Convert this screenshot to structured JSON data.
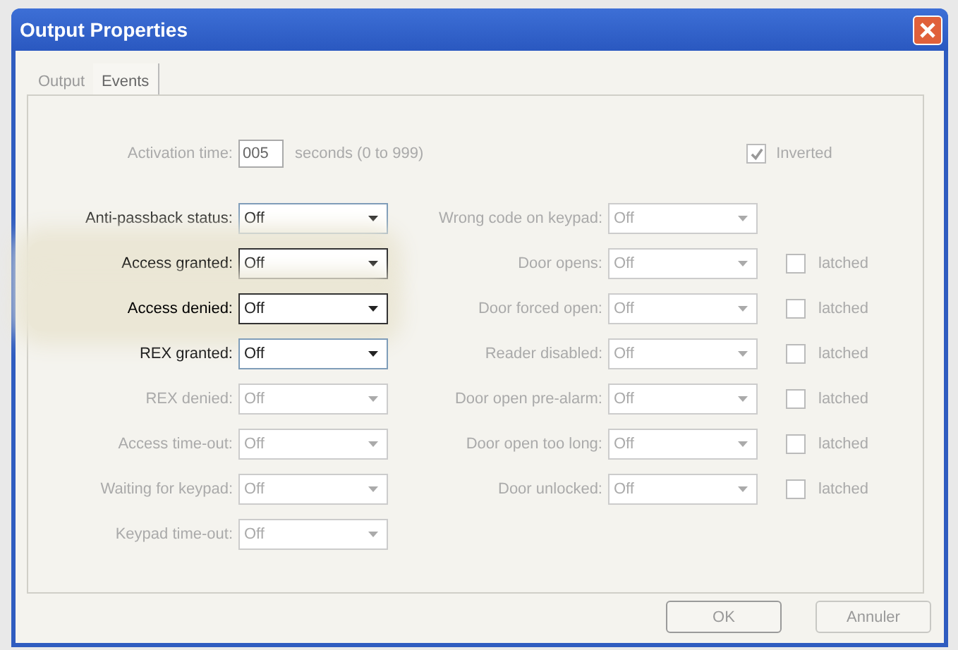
{
  "window": {
    "title": "Output Properties"
  },
  "tabs": [
    {
      "label": "Output",
      "selected": false
    },
    {
      "label": "Events",
      "selected": true
    }
  ],
  "activation": {
    "label": "Activation time:",
    "value": "005",
    "hint": "seconds (0 to 999)",
    "disabled": true
  },
  "inverted": {
    "label": "Inverted",
    "checked": true,
    "disabled": true
  },
  "left_events": [
    {
      "label": "Anti-passback status:",
      "value": "Off",
      "disabled": false,
      "highlighted": false
    },
    {
      "label": "Access granted:",
      "value": "Off",
      "disabled": false,
      "highlighted": true
    },
    {
      "label": "Access denied:",
      "value": "Off",
      "disabled": false,
      "highlighted": true
    },
    {
      "label": "REX granted:",
      "value": "Off",
      "disabled": false,
      "highlighted": false
    },
    {
      "label": "REX denied:",
      "value": "Off",
      "disabled": true,
      "highlighted": false
    },
    {
      "label": "Access time-out:",
      "value": "Off",
      "disabled": true,
      "highlighted": false
    },
    {
      "label": "Waiting for keypad:",
      "value": "Off",
      "disabled": true,
      "highlighted": false
    },
    {
      "label": "Keypad time-out:",
      "value": "Off",
      "disabled": true,
      "highlighted": false
    }
  ],
  "right_events": [
    {
      "label": "Wrong code on keypad:",
      "value": "Off",
      "disabled": true
    },
    {
      "label": "Door opens:",
      "value": "Off",
      "disabled": true,
      "latched": {
        "label": "latched",
        "checked": false
      }
    },
    {
      "label": "Door forced open:",
      "value": "Off",
      "disabled": true,
      "latched": {
        "label": "latched",
        "checked": false
      }
    },
    {
      "label": "Reader disabled:",
      "value": "Off",
      "disabled": true,
      "latched": {
        "label": "latched",
        "checked": false
      }
    },
    {
      "label": "Door open pre-alarm:",
      "value": "Off",
      "disabled": true,
      "latched": {
        "label": "latched",
        "checked": false
      }
    },
    {
      "label": "Door open too long:",
      "value": "Off",
      "disabled": true,
      "latched": {
        "label": "latched",
        "checked": false
      }
    },
    {
      "label": "Door unlocked:",
      "value": "Off",
      "disabled": true,
      "latched": {
        "label": "latched",
        "checked": false
      }
    }
  ],
  "buttons": [
    {
      "label": "OK",
      "default": true
    },
    {
      "label": "Annuler",
      "default": false
    }
  ]
}
